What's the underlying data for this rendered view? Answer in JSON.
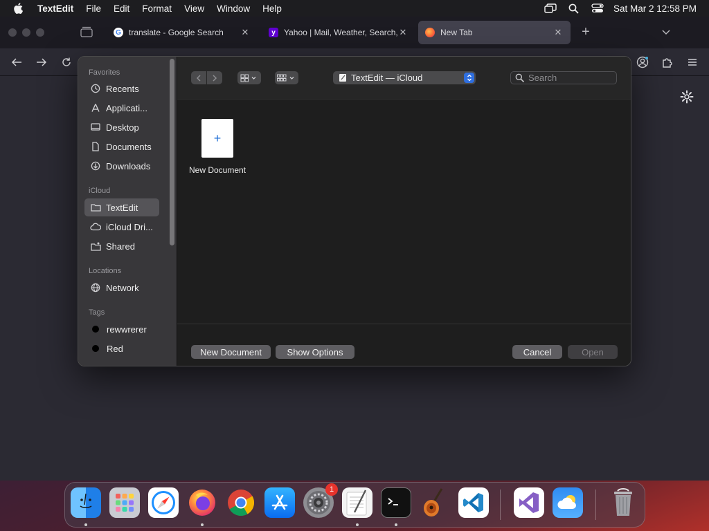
{
  "menubar": {
    "app_name": "TextEdit",
    "menus": [
      "File",
      "Edit",
      "Format",
      "View",
      "Window",
      "Help"
    ],
    "clock": "Sat Mar 2  12:58 PM"
  },
  "browser": {
    "tabs": [
      {
        "title": "translate - Google Search",
        "favicon": "google-icon"
      },
      {
        "title": "Yahoo | Mail, Weather, Search, P",
        "favicon": "yahoo-icon"
      },
      {
        "title": "New Tab",
        "favicon": "firefox-icon"
      }
    ]
  },
  "dialog": {
    "sidebar": {
      "favorites_label": "Favorites",
      "favorites": [
        "Recents",
        "Applicati...",
        "Desktop",
        "Documents",
        "Downloads"
      ],
      "icloud_label": "iCloud",
      "icloud": [
        "TextEdit",
        "iCloud Dri...",
        "Shared"
      ],
      "locations_label": "Locations",
      "locations": [
        "Network"
      ],
      "tags_label": "Tags",
      "tags": [
        "rewwrerer",
        "Red"
      ]
    },
    "location": "TextEdit — iCloud",
    "search_placeholder": "Search",
    "files": [
      {
        "name": "New Document",
        "glyph": "+"
      }
    ],
    "buttons": {
      "new_document": "New Document",
      "show_options": "Show Options",
      "cancel": "Cancel",
      "open": "Open"
    }
  },
  "dock": {
    "apps": [
      "Finder",
      "Launchpad",
      "Safari",
      "Firefox",
      "Chrome",
      "App Store",
      "System Settings",
      "TextEdit",
      "Terminal",
      "GarageBand",
      "VS Code",
      "Visual Studio",
      "Weather",
      "Trash"
    ],
    "settings_badge": "1"
  }
}
